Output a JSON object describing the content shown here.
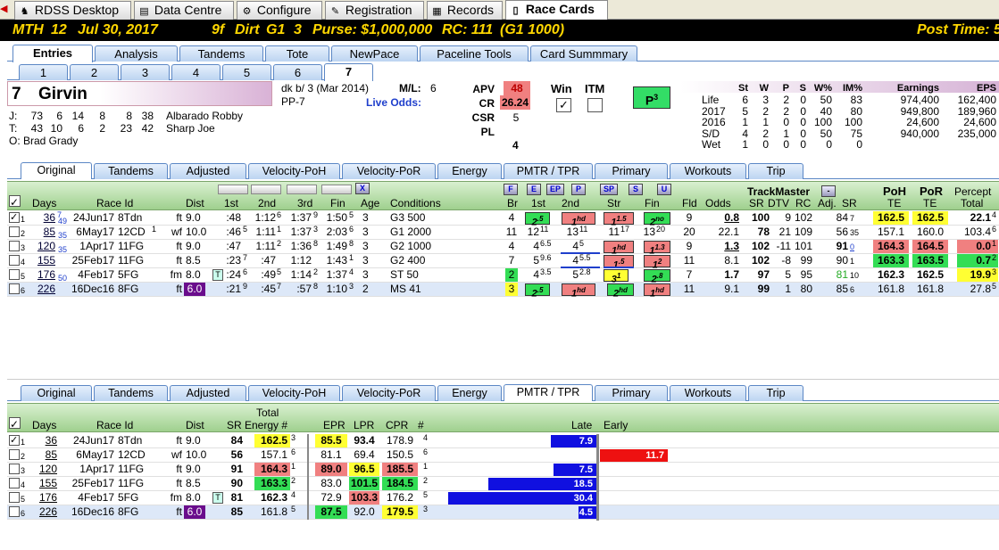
{
  "window_tabs": [
    {
      "label": "RDSS Desktop",
      "icon": "horse-icon"
    },
    {
      "label": "Data Centre",
      "icon": "folder-icon"
    },
    {
      "label": "Configure",
      "icon": "gear-icon"
    },
    {
      "label": "Registration",
      "icon": "wrench-icon"
    },
    {
      "label": "Records",
      "icon": "grid-icon"
    },
    {
      "label": "Race Cards",
      "icon": "page-icon"
    }
  ],
  "race_header": {
    "track": "MTH",
    "race": "12",
    "date": "Jul 30, 2017",
    "dist": "9f",
    "surface": "Dirt",
    "grade": "G1",
    "field": "3",
    "purse": "Purse: $1,000,000",
    "rc": "RC: 111",
    "rc_class": "(G1 1000)",
    "post_time": "Post Time: 5"
  },
  "main_tabs": [
    "Entries",
    "Analysis",
    "Tandems",
    "Tote",
    "NewPace",
    "Paceline Tools",
    "Card Summmary"
  ],
  "horse_tabs": [
    "1",
    "2",
    "3",
    "4",
    "5",
    "6",
    "7"
  ],
  "horse": {
    "number": "7",
    "name": "Girvin",
    "desc": "dk b/ 3 (Mar 2014)",
    "pp": "PP-7",
    "ml_label": "M/L:",
    "ml": "6",
    "live_odds": "Live Odds:",
    "jockey_label": "J:",
    "jockey_stats": [
      "73",
      "6",
      "14",
      "8",
      "8",
      "38"
    ],
    "jockey": "Albarado Robby",
    "trainer_label": "T:",
    "trainer_stats": [
      "43",
      "10",
      "6",
      "2",
      "23",
      "42"
    ],
    "trainer": "Sharp Joe",
    "owner_label": "O:",
    "owner": "Brad Grady",
    "apv_label": "APV",
    "apv": "48",
    "cr_label": "CR",
    "cr": "26.24",
    "csr_label": "CSR",
    "csr": "5",
    "pl_label": "PL",
    "pl": "4",
    "win_label": "Win",
    "itm_label": "ITM",
    "p_badge": "P",
    "p_sup": "3"
  },
  "record": {
    "headers": [
      "St",
      "W",
      "P",
      "S",
      "W%",
      "IM%",
      "Earnings",
      "EPS"
    ],
    "rows": [
      {
        "label": "Life",
        "vals": [
          "6",
          "3",
          "2",
          "0",
          "50",
          "83",
          "974,400",
          "162,400"
        ]
      },
      {
        "label": "2017",
        "vals": [
          "5",
          "2",
          "2",
          "0",
          "40",
          "80",
          "949,800",
          "189,960"
        ]
      },
      {
        "label": "2016",
        "vals": [
          "1",
          "1",
          "0",
          "0",
          "100",
          "100",
          "24,600",
          "24,600"
        ]
      },
      {
        "label": "S/D",
        "vals": [
          "4",
          "2",
          "1",
          "0",
          "50",
          "75",
          "940,000",
          "235,000"
        ]
      },
      {
        "label": "Wet",
        "vals": [
          "1",
          "0",
          "0",
          "0",
          "0",
          "0",
          "",
          ""
        ]
      }
    ]
  },
  "grid_tabs": [
    "Original",
    "Tandems",
    "Adjusted",
    "Velocity-PoH",
    "Velocity-PoR",
    "Energy",
    "PMTR / TPR",
    "Primary",
    "Workouts",
    "Trip"
  ],
  "top_grid": {
    "headers": {
      "days": "Days",
      "raceid": "Race Id",
      "dist": "Dist",
      "first": "1st",
      "second": "2nd",
      "third": "3rd",
      "fin": "Fin",
      "age": "Age",
      "cond": "Conditions",
      "br": "Br",
      "c1": "1st",
      "c2": "2nd",
      "str": "Str",
      "fn": "Fin",
      "fld": "Fld",
      "odds": "Odds",
      "tm": "TrackMaster",
      "sr": "SR",
      "dtv": "DTV",
      "rc": "RC",
      "adj": "Adj.",
      "adjsr": "SR",
      "poh": "PoH",
      "poh2": "TE",
      "por": "PoR",
      "por2": "TE",
      "pct": "Percept",
      "pct2": "Total",
      "x": "X",
      "f": "F",
      "e": "E",
      "ep": "EP",
      "p": "P",
      "sp": "SP",
      "s": "S",
      "u": "U",
      "minus": "-"
    },
    "rows": [
      {
        "n": "1",
        "days": "36",
        "ds": "7",
        "dd": "49",
        "date": "24Jun17",
        "race": "8Tdn",
        "fl": "",
        "surf": "ft",
        "dist": "9.0",
        "t1": ":48",
        "t2": "1:12",
        "t2s": "6",
        "t3": "1:37",
        "t3s": "9",
        "tf": "1:50",
        "tfs": "5",
        "age": "3",
        "cond": "G3 500",
        "br": "4",
        "p1": "2",
        "p1s": ".5",
        "p2": "1",
        "p2s": "hd",
        "ps": "1",
        "pss": "1.5",
        "pf": "2",
        "pfs": "no",
        "fld": "9",
        "odds": "0.8",
        "sr": "100",
        "dtv": "9",
        "rc": "102",
        "adj": "84",
        "adjs": "7",
        "poh": "162.5",
        "por": "162.5",
        "pct": "22.1",
        "pcts": "4"
      },
      {
        "n": "2",
        "days": "85",
        "ds": "",
        "dd": "35",
        "date": "6May17",
        "race": "12CD",
        "fl": "1",
        "surf": "wf",
        "dist": "10.0",
        "t1": ":46",
        "t1s": "5",
        "t2": "1:11",
        "t2s": "1",
        "t3": "1:37",
        "t3s": "3",
        "tf": "2:03",
        "tfs": "6",
        "age": "3",
        "cond": "G1 2000",
        "br": "11",
        "brs": "",
        "p1": "12",
        "p1s": "11",
        "p2": "13",
        "p2s": "11",
        "ps": "11",
        "pss": "17",
        "pf": "13",
        "pfs": "20",
        "fld": "20",
        "odds": "22.1",
        "sr": "78",
        "dtv": "21",
        "rc": "109",
        "adj": "56",
        "adjs": "35",
        "poh": "157.1",
        "por": "160.0",
        "pct": "103.4",
        "pcts": "6"
      },
      {
        "n": "3",
        "days": "120",
        "ds": "",
        "dd": "35",
        "date": "1Apr17",
        "race": "11FG",
        "fl": "",
        "surf": "ft",
        "dist": "9.0",
        "t1": ":47",
        "t2": "1:11",
        "t2s": "2",
        "t3": "1:36",
        "t3s": "8",
        "tf": "1:49",
        "tfs": "8",
        "age": "3",
        "cond": "G2 1000",
        "br": "4",
        "p1": "4",
        "p1s": "6.5",
        "p2": "4",
        "p2s": "5",
        "ps": "1",
        "pss": "hd",
        "pf": "1",
        "pfs": "1.3",
        "fld": "9",
        "odds": "1.3",
        "sr": "102",
        "dtv": "-11",
        "rc": "101",
        "adj": "91",
        "adjs": "0",
        "poh": "164.3",
        "por": "164.5",
        "pct": "0.0",
        "pcts": "1"
      },
      {
        "n": "4",
        "days": "155",
        "ds": "",
        "dd": "",
        "date": "25Feb17",
        "race": "11FG",
        "fl": "",
        "surf": "ft",
        "dist": "8.5",
        "t1": ":23",
        "t1s": "7",
        "t2": ":47",
        "t3": "1:12",
        "tf": "1:43",
        "tfs": "1",
        "age": "3",
        "cond": "G2 400",
        "br": "7",
        "p1": "5",
        "p1s": "9.6",
        "p2": "4",
        "p2s": "5.5",
        "ps": "1",
        "pss": ".5",
        "pf": "1",
        "pfs": "2",
        "fld": "11",
        "odds": "8.1",
        "sr": "102",
        "dtv": "-8",
        "rc": "99",
        "adj": "90",
        "adjs": "1",
        "poh": "163.3",
        "por": "163.5",
        "pct": "0.7",
        "pcts": "2"
      },
      {
        "n": "5",
        "days": "176",
        "ds": "",
        "dd": "50",
        "date": "4Feb17",
        "race": "5FG",
        "fl": "",
        "surf": "fm",
        "dist": "8.0",
        "t1": ":24",
        "t1s": "6",
        "t2": ":49",
        "t2s": "5",
        "t3": "1:14",
        "t3s": "2",
        "tf": "1:37",
        "tfs": "4",
        "age": "3",
        "cond": "ST 50",
        "br": "2",
        "p1": "4",
        "p1s": "3.5",
        "p2": "5",
        "p2s": "2.8",
        "ps": "3",
        "pss": "1",
        "pf": "2",
        "pfs": ".8",
        "fld": "7",
        "odds": "1.7",
        "sr": "97",
        "dtv": "5",
        "rc": "95",
        "adj": "81",
        "adjs": "10",
        "poh": "162.3",
        "por": "162.5",
        "pct": "19.9",
        "pcts": "3"
      },
      {
        "n": "6",
        "days": "226",
        "ds": "",
        "dd": "",
        "date": "16Dec16",
        "race": "8FG",
        "fl": "",
        "surf": "ft",
        "dist": "6.0",
        "t1": ":21",
        "t1s": "9",
        "t2": ":45",
        "t2s": "7",
        "t3": ":57",
        "t3s": "8",
        "tf": "1:10",
        "tfs": "3",
        "age": "2",
        "cond": "MS 41",
        "br": "3",
        "p1": "2",
        "p1s": ".5",
        "p2": "1",
        "p2s": "hd",
        "ps": "2",
        "pss": "hd",
        "pf": "1",
        "pfs": "hd",
        "fld": "11",
        "odds": "9.1",
        "sr": "99",
        "dtv": "1",
        "rc": "80",
        "adj": "85",
        "adjs": "6",
        "poh": "161.8",
        "por": "161.8",
        "pct": "27.8",
        "pcts": "5"
      }
    ]
  },
  "bottom_grid": {
    "headers": {
      "days": "Days",
      "raceid": "Race Id",
      "dist": "Dist",
      "sr": "SR",
      "total": "Total",
      "energy": "Energy #",
      "epr": "EPR",
      "lpr": "LPR",
      "cpr": "CPR",
      "hash": "#",
      "late": "Late",
      "early": "Early"
    },
    "rows": [
      {
        "n": "1",
        "days": "36",
        "date": "24Jun17",
        "race": "8Tdn",
        "surf": "ft",
        "dist": "9.0",
        "sr": "84",
        "en": "162.5",
        "ens": "3",
        "epr": "85.5",
        "lpr": "93.4",
        "cpr": "178.9",
        "h": "4",
        "bar": "7.9",
        "side": "late",
        "frac": 0.31
      },
      {
        "n": "2",
        "days": "85",
        "date": "6May17",
        "race": "12CD",
        "surf": "wf",
        "dist": "10.0",
        "sr": "56",
        "en": "157.1",
        "ens": "6",
        "epr": "81.1",
        "lpr": "69.4",
        "cpr": "150.5",
        "h": "6",
        "bar": "11.7",
        "side": "early",
        "frac": 0.46
      },
      {
        "n": "3",
        "days": "120",
        "date": "1Apr17",
        "race": "11FG",
        "surf": "ft",
        "dist": "9.0",
        "sr": "91",
        "en": "164.3",
        "ens": "1",
        "epr": "89.0",
        "lpr": "96.5",
        "cpr": "185.5",
        "h": "1",
        "bar": "7.5",
        "side": "late",
        "frac": 0.29
      },
      {
        "n": "4",
        "days": "155",
        "date": "25Feb17",
        "race": "11FG",
        "surf": "ft",
        "dist": "8.5",
        "sr": "90",
        "en": "163.3",
        "ens": "2",
        "epr": "83.0",
        "lpr": "101.5",
        "cpr": "184.5",
        "h": "2",
        "bar": "18.5",
        "side": "late",
        "frac": 0.73
      },
      {
        "n": "5",
        "days": "176",
        "date": "4Feb17",
        "race": "5FG",
        "surf": "fm",
        "dist": "8.0",
        "sr": "81",
        "en": "162.3",
        "ens": "4",
        "epr": "72.9",
        "lpr": "103.3",
        "cpr": "176.2",
        "h": "5",
        "bar": "30.4",
        "side": "late",
        "frac": 1.0
      },
      {
        "n": "6",
        "days": "226",
        "date": "16Dec16",
        "race": "8FG",
        "surf": "ft",
        "dist": "6.0",
        "sr": "85",
        "en": "161.8",
        "ens": "5",
        "epr": "87.5",
        "lpr": "92.0",
        "cpr": "179.5",
        "h": "3",
        "bar": "4.5",
        "side": "late",
        "frac": 0.12
      }
    ]
  },
  "colors": {
    "gold": "#ffd700",
    "yellow": "#ffff33",
    "green": "#33dd55",
    "red": "#f08080",
    "pink": "#f7b3b3",
    "purple": "#6a0d8c",
    "blue": "#1010e0",
    "barred": "#ee1111"
  }
}
